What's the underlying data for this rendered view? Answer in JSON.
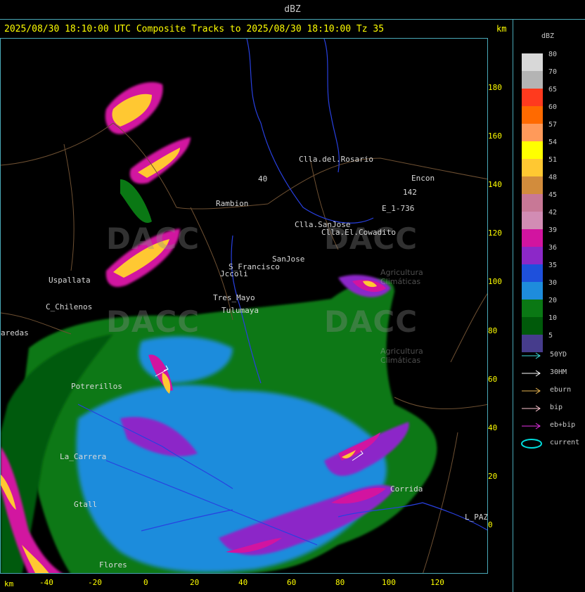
{
  "topbar": {
    "title": "dBZ"
  },
  "header": {
    "text": "2025/08/30 18:10:00 UTC Composite Tracks to 2025/08/30 18:10:00 Tz 35",
    "unit": "km"
  },
  "y_axis": {
    "ticks": [
      "180",
      "160",
      "140",
      "120",
      "100",
      "80",
      "60",
      "40",
      "20",
      "0"
    ]
  },
  "x_axis": {
    "unit": "km",
    "ticks": [
      "-40",
      "-20",
      "0",
      "20",
      "40",
      "60",
      "80",
      "100",
      "120"
    ]
  },
  "legend": {
    "title": "dBZ",
    "levels": [
      {
        "label": "80",
        "color": "#d8d8d8"
      },
      {
        "label": "70",
        "color": "#b4b4b4"
      },
      {
        "label": "65",
        "color": "#ff3a1e"
      },
      {
        "label": "60",
        "color": "#ff6a00"
      },
      {
        "label": "57",
        "color": "#ff9a5a"
      },
      {
        "label": "54",
        "color": "#ffff00"
      },
      {
        "label": "51",
        "color": "#ffc832"
      },
      {
        "label": "48",
        "color": "#d28c3c"
      },
      {
        "label": "45",
        "color": "#c87896"
      },
      {
        "label": "42",
        "color": "#d28cb4"
      },
      {
        "label": "39",
        "color": "#d214a0"
      },
      {
        "label": "36",
        "color": "#8c28c8"
      },
      {
        "label": "35",
        "color": "#1e50dc"
      },
      {
        "label": "30",
        "color": "#1e8cdc"
      },
      {
        "label": "20",
        "color": "#0a7814"
      },
      {
        "label": "10",
        "color": "#005a0a"
      },
      {
        "label": "5",
        "color": "#463c8c"
      }
    ],
    "tracks": [
      {
        "label": "50YD",
        "color": "#3cdcdc"
      },
      {
        "label": "30HM",
        "color": "#ffffff"
      },
      {
        "label": "eburn",
        "color": "#e6b450"
      },
      {
        "label": "bip",
        "color": "#ffc8d2"
      },
      {
        "label": "eb+bip",
        "color": "#e632e6"
      },
      {
        "label": "current",
        "color": "#00dcdc"
      }
    ]
  },
  "places": {
    "clla_del_rosario": "Clla.del.Rosario",
    "encon": "Encon",
    "route_142": "142",
    "e_1_736": "E_1-736",
    "rambion": "Rambion",
    "clla_sanjose": "Clla.SanJose",
    "clla_el_cowadito": "Clla.El.Cowadito",
    "uspallata": "Uspallata",
    "s_francisco": "S_Francisco",
    "sanjose": "SanJose",
    "c_chilenos": "C_Chilenos",
    "tres_mayo": "Tres_Mayo",
    "tulumaya": "Tulumaya",
    "ccolli": "Jccoli",
    "corrida": "Corrida",
    "l_paz": "L_PAZ",
    "gtall": "Gtall",
    "potrerillos": "Potrerillos",
    "la_carrera": "La_Carrera",
    "flores": "Flores",
    "aredas": "aredas",
    "route_40": "40"
  },
  "watermarks": {
    "brand": "DACC",
    "sub_line1": "Agricultura",
    "sub_line2": "Climáticas"
  }
}
